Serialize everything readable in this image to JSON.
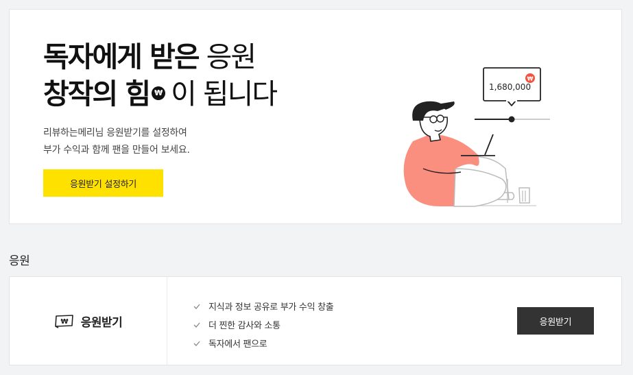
{
  "hero": {
    "title_line1_bold": "독자에게 받은",
    "title_line1_thin": "응원",
    "title_line2_bold": "창작의 힘",
    "won_symbol": "₩",
    "title_line2_thin": "이 됩니다",
    "description": [
      "리뷰하는메리님 응원받기를 설정하여",
      "부가 수익과 함께 팬을 만들어 보세요."
    ],
    "setup_button_label": "응원받기 설정하기",
    "illustration": {
      "amount": "1,680,000",
      "badge_symbol": "₩",
      "badge_color": "#f0533f",
      "body_color": "#fa8f80"
    }
  },
  "section": {
    "title": "응원"
  },
  "card": {
    "icon": "money-bill-icon",
    "label": "응원받기",
    "benefits": [
      "지식과 정보 공유로 부가 수익 창출",
      "더 찐한 감사와 소통",
      "독자에서 팬으로"
    ],
    "button_label": "응원받기"
  },
  "colors": {
    "accent_yellow": "#ffe100",
    "dark_button": "#333333",
    "background": "#f2f3f5"
  }
}
